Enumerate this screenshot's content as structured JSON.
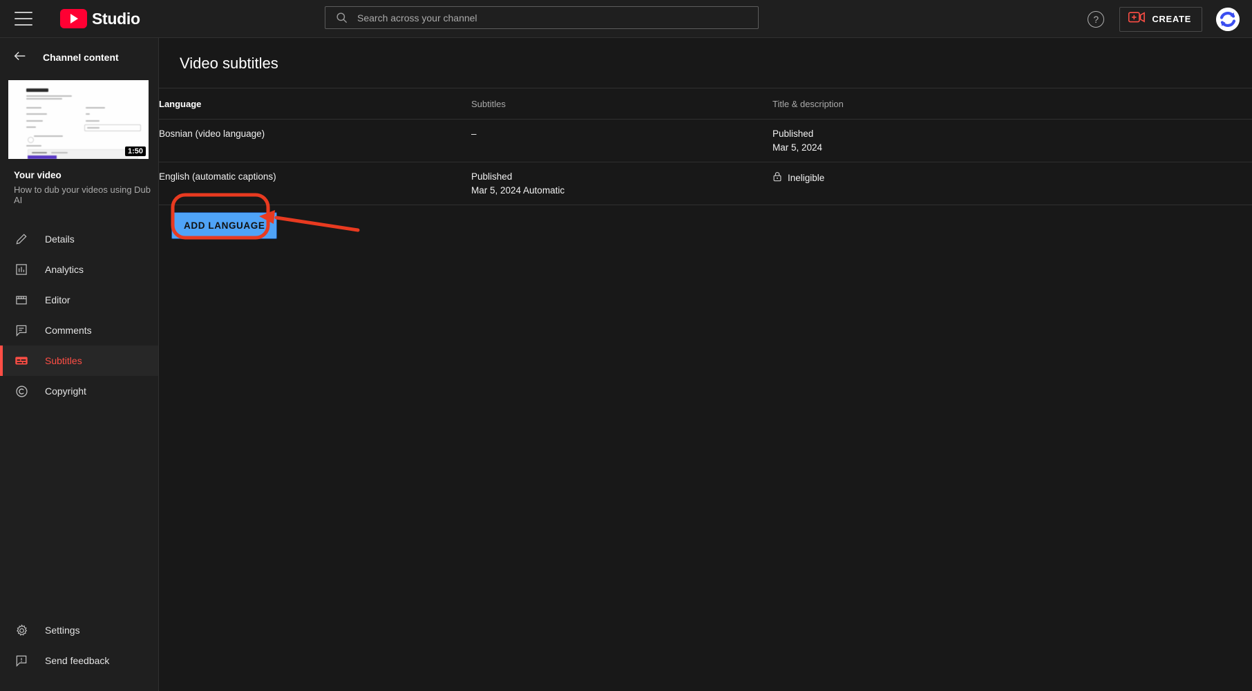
{
  "topbar": {
    "hamburger_icon": "hamburger-menu-icon",
    "brand_text": "Studio",
    "logo_icon": "youtube-logo-icon",
    "search": {
      "icon": "search-icon",
      "placeholder": "Search across your channel",
      "value": ""
    },
    "help_label": "?",
    "create_label": "CREATE",
    "create_icon": "video-plus-icon",
    "avatar_icon": "avatar-sync-arrows-icon"
  },
  "sidebar": {
    "back_icon": "arrow-left-icon",
    "back_label": "Channel content",
    "thumbnail": {
      "heading": "Dubbing",
      "duration": "1:50"
    },
    "video_title": "Your video",
    "video_description": "How to dub your videos using Dub AI",
    "items": [
      {
        "label": "Details",
        "icon": "pencil-icon",
        "active": false
      },
      {
        "label": "Analytics",
        "icon": "bar-chart-icon",
        "active": false
      },
      {
        "label": "Editor",
        "icon": "clapperboard-icon",
        "active": false
      },
      {
        "label": "Comments",
        "icon": "comment-icon",
        "active": false
      },
      {
        "label": "Subtitles",
        "icon": "subtitles-icon",
        "active": true
      },
      {
        "label": "Copyright",
        "icon": "copyright-icon",
        "active": false
      }
    ],
    "bottom_items": [
      {
        "label": "Settings",
        "icon": "gear-icon"
      },
      {
        "label": "Send feedback",
        "icon": "feedback-icon"
      }
    ]
  },
  "main": {
    "page_title": "Video subtitles",
    "table": {
      "headers": [
        "Language",
        "Subtitles",
        "Title & description"
      ],
      "rows": [
        {
          "language": "Bosnian (video language)",
          "subtitles_line1": "–",
          "subtitles_line2": "",
          "title_line1": "Published",
          "title_line2": "Mar 5, 2024",
          "title_locked": false
        },
        {
          "language": "English (automatic captions)",
          "subtitles_line1": "Published",
          "subtitles_line2": "Mar 5, 2024 Automatic",
          "title_line1": "Ineligible",
          "title_line2": "",
          "title_locked": true,
          "lock_icon": "lock-icon"
        }
      ]
    },
    "add_language_label": "ADD LANGUAGE"
  },
  "annotation": {
    "color": "#e83a20",
    "shape": "rounded-rectangle-highlight",
    "arrow": "arrow-pointing-left"
  },
  "colors": {
    "accent_red": "#ff4e45",
    "brand_red": "#ff0033",
    "button_blue": "#4fa3f7",
    "bg_main": "#181818",
    "bg_panel": "#1f1f1f",
    "annotation_red": "#e83a20"
  }
}
